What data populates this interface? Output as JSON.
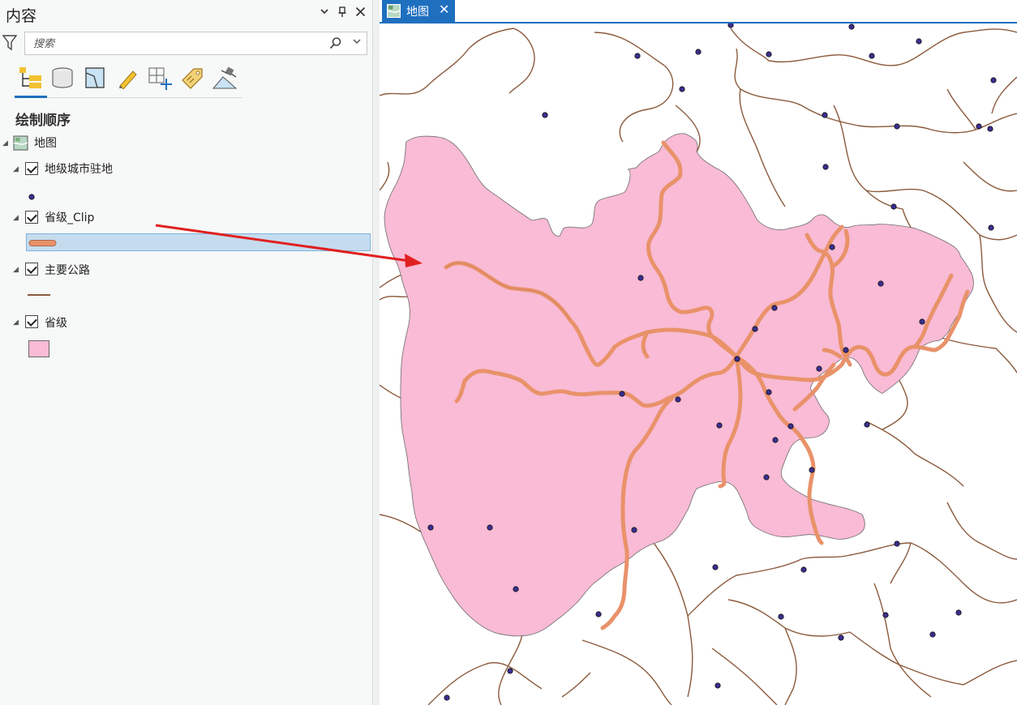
{
  "contents_pane": {
    "title": "内容",
    "controls": {
      "menu": "⌄",
      "pin": "📌",
      "close": "✕"
    },
    "search": {
      "placeholder": "搜索"
    },
    "toolbar": {
      "tools": [
        "list-by-drawing-order-icon",
        "list-by-source-icon",
        "list-by-selection-icon",
        "list-by-editing-icon",
        "list-by-snapping-icon",
        "list-by-labeling-icon",
        "list-by-perspective-imagery-icon"
      ],
      "active": "list-by-drawing-order-icon"
    },
    "section_heading": "绘制顺序",
    "tree": {
      "map_label": "地图",
      "layers": [
        {
          "label": "地级城市驻地",
          "checked": true,
          "symbol": "point"
        },
        {
          "label": "省级_Clip",
          "checked": true,
          "symbol": "thick-line",
          "selected": true
        },
        {
          "label": "主要公路",
          "checked": true,
          "symbol": "line"
        },
        {
          "label": "省级",
          "checked": true,
          "symbol": "polygon"
        }
      ]
    }
  },
  "map_view": {
    "tab_label": "地图",
    "tab_close": "✕"
  },
  "colors": {
    "accent": "#1f6fbf",
    "polygon_fill": "#f9bbd5",
    "clip_road": "#e9926a",
    "road_line": "#8b5a3c",
    "city_point": "#3b2f8f",
    "selection": "#c5dcef",
    "arrow": "#e02020"
  }
}
